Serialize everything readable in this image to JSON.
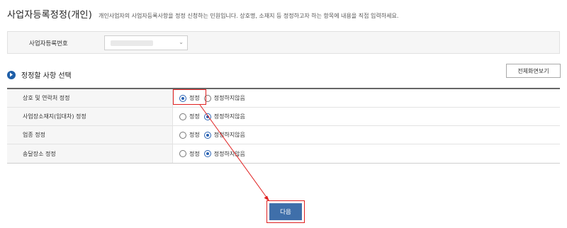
{
  "header": {
    "title": "사업자등록정정(개인)",
    "description": "개인사업자의 사업자등록사항을 정정 신청하는 민원입니다. 상호명, 소재지 등 정정하고자 하는 항목에 내용을 직접 입력하세요."
  },
  "business_number": {
    "label": "사업자등록번호",
    "value": ""
  },
  "section": {
    "title": "정정할 사항 선택",
    "fullscreen_label": "전체화면보기"
  },
  "rows": [
    {
      "label": "상호 및 연락처 정정",
      "option_yes": "정정",
      "option_no": "정정하지않음",
      "selected": "정정"
    },
    {
      "label": "사업장소재지(임대차) 정정",
      "option_yes": "정정",
      "option_no": "정정하지않음",
      "selected": "정정하지않음"
    },
    {
      "label": "업종 정정",
      "option_yes": "정정",
      "option_no": "정정하지않음",
      "selected": "정정하지않음"
    },
    {
      "label": "송달장소 정정",
      "option_yes": "정정",
      "option_no": "정정하지않음",
      "selected": "정정하지않음"
    }
  ],
  "next_button": {
    "label": "다음"
  },
  "colors": {
    "accent": "#3f6faa",
    "radio_selected": "#2a63b4",
    "highlight": "#e02020",
    "section_dot": "#1f5fa8"
  },
  "icons": {
    "section": "chevron-right-circle-icon",
    "select": "chevron-down-icon"
  }
}
